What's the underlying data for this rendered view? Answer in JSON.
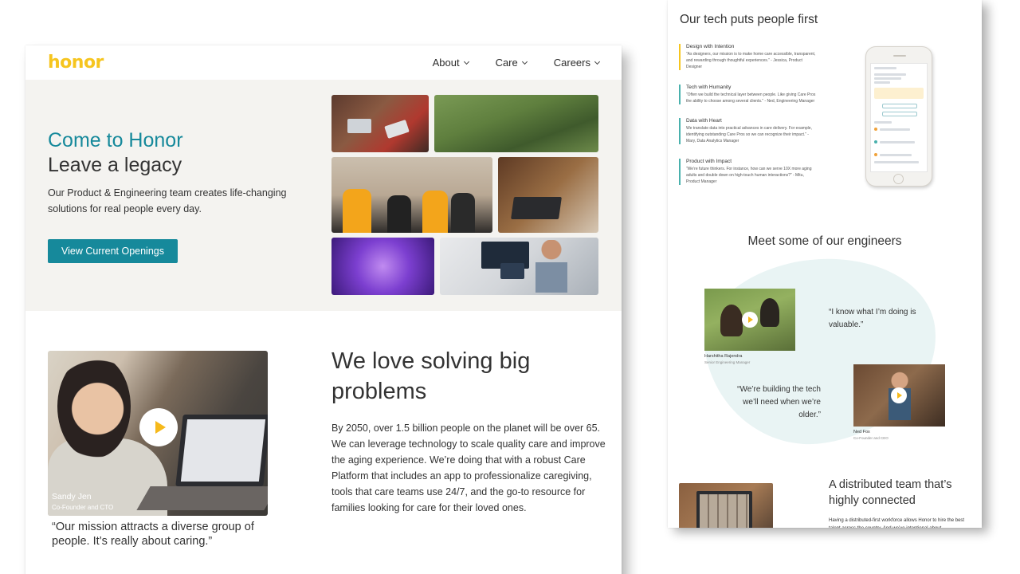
{
  "left_page": {
    "nav": {
      "logo": "honor",
      "items": [
        {
          "label": "About"
        },
        {
          "label": "Care"
        },
        {
          "label": "Careers"
        }
      ]
    },
    "hero": {
      "title_line1": "Come to Honor",
      "title_line2": "Leave a legacy",
      "subtitle": "Our Product & Engineering team creates life-changing solutions for real people every day.",
      "cta_label": "View Current Openings"
    },
    "video": {
      "person_name": "Sandy Jen",
      "person_role": "Co-Founder and CTO"
    },
    "quote": "“Our mission attracts a diverse group of people. It’s really about caring.”",
    "section": {
      "heading": "We love solving big problems",
      "body": "By 2050, over 1.5 billion people on the planet will be over 65. We can leverage technology to scale quality care and improve the aging experience. We’re doing that with a robust Care Platform that includes an app to professionalize caregiving, tools that care teams use 24/7, and the go-to resource for families looking for care for their loved ones."
    }
  },
  "right_page": {
    "title": "Our tech puts people first",
    "principles": [
      {
        "name": "Design with Intention",
        "text": "“As designers, our mission is to make home care accessible, transparent, and rewarding through thoughtful experiences.” - Jessica, Product Designer"
      },
      {
        "name": "Tech with Humanity",
        "text": "“Often we build the technical layer between people. Like giving Care Pros the ability to choose among several clients.” - Ned, Engineering Manager"
      },
      {
        "name": "Data with Heart",
        "text": "We translate data into practical advances in care delivery. For example, identifying outstanding Care Pros so we can recognize their impact.” - Mary, Data Analytics Manager"
      },
      {
        "name": "Product with Impact",
        "text": "“We’re future thinkers. For instance, how can we serve 10X more aging adults and double down on high-touch human interactions?” - Mitu, Product Manager"
      }
    ],
    "engineers_heading": "Meet some of our engineers",
    "engineers": [
      {
        "name": "Harshitha Rajendra",
        "role": "Senior Engineering Manager",
        "quote": "“I know what I’m doing is valuable.”"
      },
      {
        "name": "Ned Fox",
        "role": "Co-Founder and CEO",
        "quote": "“We’re building the tech we’ll need when we’re older.”"
      }
    ],
    "distributed": {
      "heading": "A distributed team that’s highly connected",
      "body": "Having a distributed-first workforce allows Honor to hire the best talent across the country. And we’ve intentional about"
    }
  },
  "colors": {
    "brand_yellow": "#f6c51f",
    "brand_teal": "#16899b",
    "hero_bg": "#f4f3f0",
    "blob": "#e9f4f4"
  }
}
